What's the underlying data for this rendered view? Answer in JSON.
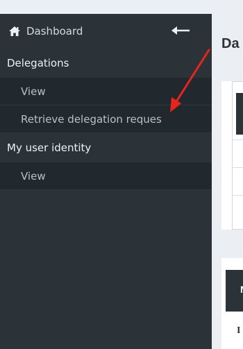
{
  "sidebar": {
    "header": {
      "label": "Dashboard",
      "home_icon": "home-icon",
      "back_icon": "arrow-left-icon"
    },
    "sections": [
      {
        "title": "Delegations",
        "items": [
          {
            "label": "View"
          },
          {
            "label": "Retrieve delegation reques"
          }
        ]
      },
      {
        "title": "My user identity",
        "items": [
          {
            "label": "View"
          }
        ]
      }
    ]
  },
  "main": {
    "page_title": "Da",
    "card2_header_char": "N",
    "card2_row_char": "I"
  },
  "annotation": {
    "color": "#e8241b"
  },
  "colors": {
    "sidebar_bg": "#2b3339",
    "item_bg": "#22292e",
    "main_bg": "#ebeef2"
  }
}
